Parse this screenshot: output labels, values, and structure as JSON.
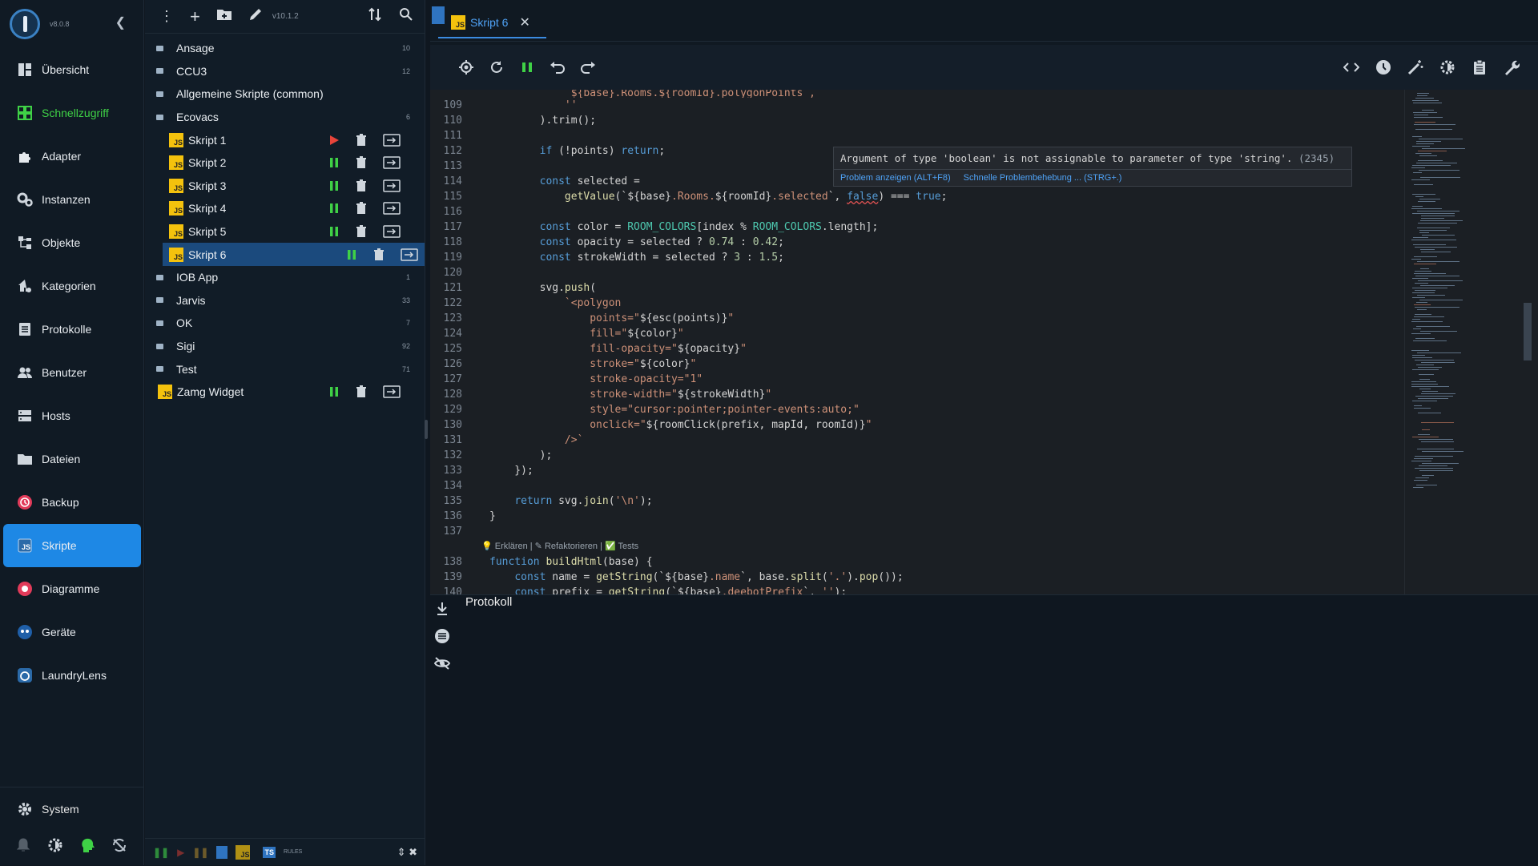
{
  "app": {
    "version": "v8.0.8"
  },
  "nav": {
    "items": [
      {
        "id": "uebersicht",
        "label": "Übersicht",
        "icon": "dashboard-icon"
      },
      {
        "id": "schnellzugriff",
        "label": "Schnellzugriff",
        "icon": "grid-icon"
      },
      {
        "id": "adapter",
        "label": "Adapter",
        "icon": "puzzle-icon"
      },
      {
        "id": "instanzen",
        "label": "Instanzen",
        "icon": "gears-icon"
      },
      {
        "id": "objekte",
        "label": "Objekte",
        "icon": "objects-icon"
      },
      {
        "id": "kategorien",
        "label": "Kategorien",
        "icon": "categories-icon"
      },
      {
        "id": "protokolle",
        "label": "Protokolle",
        "icon": "log-icon"
      },
      {
        "id": "benutzer",
        "label": "Benutzer",
        "icon": "users-icon"
      },
      {
        "id": "hosts",
        "label": "Hosts",
        "icon": "server-icon"
      },
      {
        "id": "dateien",
        "label": "Dateien",
        "icon": "folder-icon"
      },
      {
        "id": "backup",
        "label": "Backup",
        "icon": "backup-icon"
      },
      {
        "id": "skripte",
        "label": "Skripte",
        "icon": "js-icon",
        "active": true
      },
      {
        "id": "diagramme",
        "label": "Diagramme",
        "icon": "chart-icon"
      },
      {
        "id": "geraete",
        "label": "Geräte",
        "icon": "devices-icon"
      },
      {
        "id": "laundrylens",
        "label": "LaundryLens",
        "icon": "laundry-icon"
      }
    ],
    "system_label": "System"
  },
  "tree": {
    "version": "v10.1.2",
    "rows": [
      {
        "type": "folder",
        "label": "Ansage",
        "count": "10"
      },
      {
        "type": "folder",
        "label": "CCU3",
        "count": "12"
      },
      {
        "type": "folder",
        "label": "Allgemeine Skripte (common)",
        "count": ""
      },
      {
        "type": "folder",
        "label": "Ecovacs",
        "count": "6"
      },
      {
        "type": "script",
        "label": "Skript 1",
        "state": "stopped"
      },
      {
        "type": "script",
        "label": "Skript 2",
        "state": "running"
      },
      {
        "type": "script",
        "label": "Skript 3",
        "state": "running"
      },
      {
        "type": "script",
        "label": "Skript 4",
        "state": "running"
      },
      {
        "type": "script",
        "label": "Skript 5",
        "state": "running"
      },
      {
        "type": "script",
        "label": "Skript 6",
        "state": "running",
        "selected": true
      },
      {
        "type": "folder",
        "label": "IOB App",
        "count": "1"
      },
      {
        "type": "folder",
        "label": "Jarvis",
        "count": "33"
      },
      {
        "type": "folder",
        "label": "OK",
        "count": "7"
      },
      {
        "type": "folder",
        "label": "Sigi",
        "count": "92"
      },
      {
        "type": "folder",
        "label": "Test",
        "count": "71"
      },
      {
        "type": "script-top",
        "label": "Zamg Widget",
        "state": "running"
      }
    ],
    "footer": {
      "js": "JS",
      "ts": "TS",
      "rules": "RULES"
    }
  },
  "editor": {
    "tab_label": "Skript 6",
    "hover": {
      "message": "Argument of type 'boolean' is not assignable to parameter of type 'string'.",
      "code": "(2345)",
      "link1": "Problem anzeigen (ALT+F8)",
      "link2": "Schnelle Problembehebung ... (STRG+.)"
    },
    "codelens": "💡 Erklären | ✎ Refaktorieren | ✅ Tests",
    "log_title": "Protokoll"
  }
}
